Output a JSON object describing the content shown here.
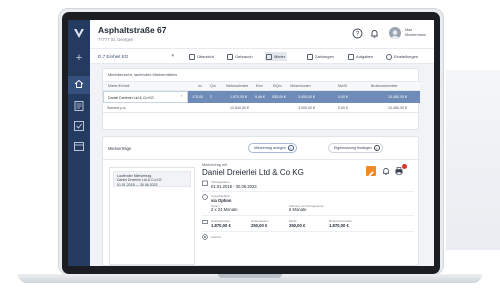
{
  "header": {
    "title": "Asphaltstraße 67",
    "subtitle": "77777 St. Georgen",
    "user_line1": "Max",
    "user_line2": "Mustermann"
  },
  "toolbar": {
    "unit": "D.7 Einheit EG",
    "tabs": [
      {
        "label": "Übersicht",
        "icon": "overview-icon"
      },
      {
        "label": "Gebrauch",
        "icon": "building-icon"
      },
      {
        "label": "Mieter",
        "icon": "tenant-icon",
        "active": true
      },
      {
        "label": "Zahlungen",
        "icon": "payment-icon"
      },
      {
        "label": "Aufgaben",
        "icon": "tasks-icon"
      },
      {
        "label": "Einstellungen",
        "icon": "settings-icon"
      }
    ]
  },
  "overview": {
    "title": "Mietübersicht, laufendes Mietverhältnis",
    "columns": [
      "Mieter/Einheit",
      "m²",
      "Qm",
      "Nettokaltmiete",
      "€/m²",
      "€/Qm",
      "Nebenkosten",
      "MwSt",
      "Bruttowarmmiete"
    ],
    "selected_row": {
      "tenant": "Daniel Dreierlei Ltd & Co KG",
      "unit": "170,00",
      "qm": "2",
      "net_rent": "1.870,00 €",
      "per_m2": "9,46 €",
      "per_qm": "935,00 €",
      "ancillary": "3.000,00 €",
      "vat": "0,00 €",
      "gross": "10.480,00 €"
    },
    "sum_row": {
      "label": "Summe p.a.",
      "net_rent": "12.840,00 €",
      "ancillary": "3.000,00 €",
      "vat": "0,00 €",
      "gross": "10.480,00 €"
    }
  },
  "contracts": {
    "title": "Mietverträge",
    "add_button": "Mietvertrag anlegen",
    "import_button": "Eigennutzung festlegen",
    "list_item": {
      "line1": "Laufender Mietvertrag",
      "line2": "Daniel Dreierlei Ltd & Co KG",
      "line3": "01.01.2018 — 30.06.2023"
    },
    "detail": {
      "label": "Mietvertrag mit",
      "name": "Daniel Dreierlei Ltd & Co KG",
      "period_label": "Vertragsdauer",
      "period": "01.01.2018 - 30.06.2023",
      "option_label": "Ausschließlich",
      "option_value": "via Option",
      "option_sub_label": "Option",
      "option_sub_value": "2 x 24 Monate",
      "payment_label": "Zahlung vor Vertragsende",
      "payment_value": "6 Monate",
      "net_label": "Nettokaltmiete",
      "net_value": "1.870,00 €",
      "anc_label": "Nebenkosten",
      "anc_value": "250,00 €",
      "vat_label": "MwSt",
      "vat_value": "250,00 €",
      "gross_label": "Bruttowarmmiete",
      "gross_value": "1.870,00 €",
      "deposit_label": "Kaution"
    }
  },
  "colors": {
    "sidebar": "#243a5e",
    "accent_row": "#6f8bb8",
    "edit_button": "#f08a24",
    "notification": "#d9342b"
  }
}
